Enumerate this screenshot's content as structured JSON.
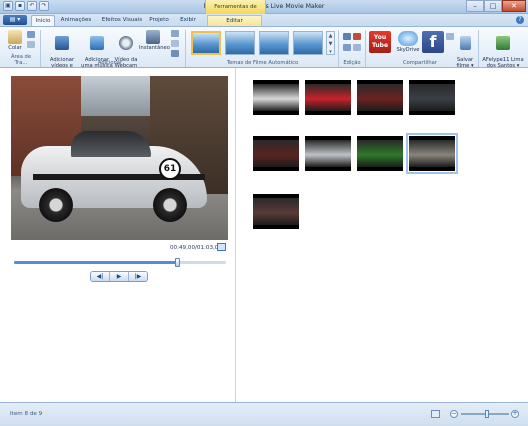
{
  "window": {
    "title": "Meu Filme - Windows Live Movie Maker",
    "contextual_tab_group": "Ferramentas de Vídeo",
    "minimize": "–",
    "maximize": "□",
    "close": "✕"
  },
  "tabs": [
    {
      "label": "Início"
    },
    {
      "label": "Animações"
    },
    {
      "label": "Efeitos Visuais"
    },
    {
      "label": "Projeto"
    },
    {
      "label": "Exibir"
    },
    {
      "label": "Editar"
    }
  ],
  "ribbon": {
    "clipboard": {
      "group_label": "Área de Tra...",
      "paste_label": "Colar"
    },
    "add": {
      "group_label": "Adicionar",
      "add_videos_label": "Adicionar\nvídeos e fotos",
      "add_music_label": "Adicionar\numa música ▾",
      "webcam_label": "Vídeo da\nWebcam",
      "snapshot_label": "Instantâneo"
    },
    "themes": {
      "group_label": "Temas de Filme Automático"
    },
    "edit": {
      "group_label": "Edição"
    },
    "share": {
      "group_label": "Compartilhar",
      "youtube_label": "You\nTube",
      "skydrive_label": "SkyDrive",
      "save_label": "Salvar\nfilme ▾",
      "user_label": "AFelype11 Lima\ndos Santos ▾"
    }
  },
  "preview": {
    "car_number": "61",
    "time_display": "00:49,00/01:03,00",
    "progress": 0.77
  },
  "transport": {
    "prev": "◀|",
    "play": "▶",
    "next": "|▶"
  },
  "status": {
    "text": "Item 8 de 9",
    "zoom_minus": "−",
    "zoom_plus": "+",
    "zoom_level": 0.55
  },
  "thumbnails": [
    {
      "name": "clip-1",
      "color": "#d8d8d8"
    },
    {
      "name": "clip-2",
      "color": "#c8222a"
    },
    {
      "name": "clip-3",
      "color": "#6e2320"
    },
    {
      "name": "clip-4",
      "color": "#3a3e46"
    },
    {
      "name": "clip-5",
      "color": "#5a2420"
    },
    {
      "name": "clip-6",
      "color": "#bfc3c7"
    },
    {
      "name": "clip-7",
      "color": "#2f7a2a"
    },
    {
      "name": "clip-8",
      "color": "#8a857c",
      "selected": true
    },
    {
      "name": "clip-9",
      "color": "#5a3a36"
    }
  ]
}
